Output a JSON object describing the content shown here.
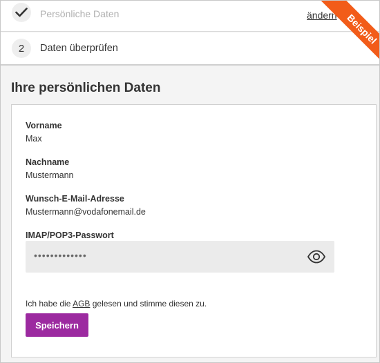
{
  "steps": [
    {
      "label": "Persönliche Daten",
      "status": "done",
      "action": "ändern"
    },
    {
      "number": "2",
      "label": "Daten überprüfen"
    }
  ],
  "ribbon": {
    "text": "Beispiel",
    "color": "#f25c19"
  },
  "section": {
    "title": "Ihre persönlichen Daten"
  },
  "fields": [
    {
      "label": "Vorname",
      "value": "Max"
    },
    {
      "label": "Nachname",
      "value": "Mustermann"
    },
    {
      "label": "Wunsch-E-Mail-Adresse",
      "value": "Mustermann@vodafonemail.de"
    }
  ],
  "password": {
    "label": "IMAP/POP3-Passwort",
    "value": "•••••••••••••",
    "toggle_icon": "eye-icon"
  },
  "agb": {
    "before": "Ich habe die ",
    "link": "AGB",
    "after": " gelesen und stimme diesen zu."
  },
  "save_button": {
    "label": "Speichern",
    "color": "#9c2aa0"
  }
}
